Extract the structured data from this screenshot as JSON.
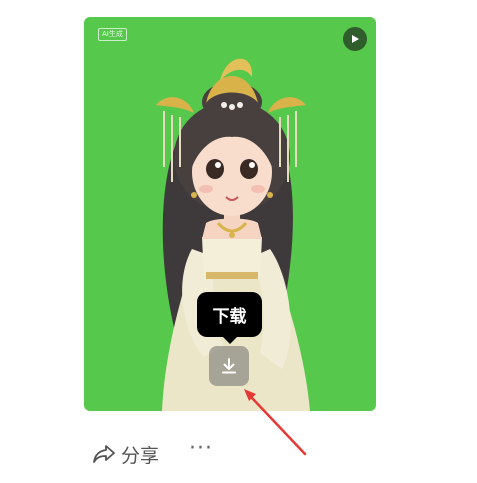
{
  "card": {
    "background": "#56c84b",
    "watermark": "AI生成",
    "play_icon": "play-icon"
  },
  "tooltip": {
    "label": "下载"
  },
  "download": {
    "icon": "download-icon"
  },
  "actions": {
    "share_label": "分享",
    "share_icon": "share-arrow-icon",
    "more_label": "···"
  },
  "annotation": {
    "color": "#e53935"
  }
}
